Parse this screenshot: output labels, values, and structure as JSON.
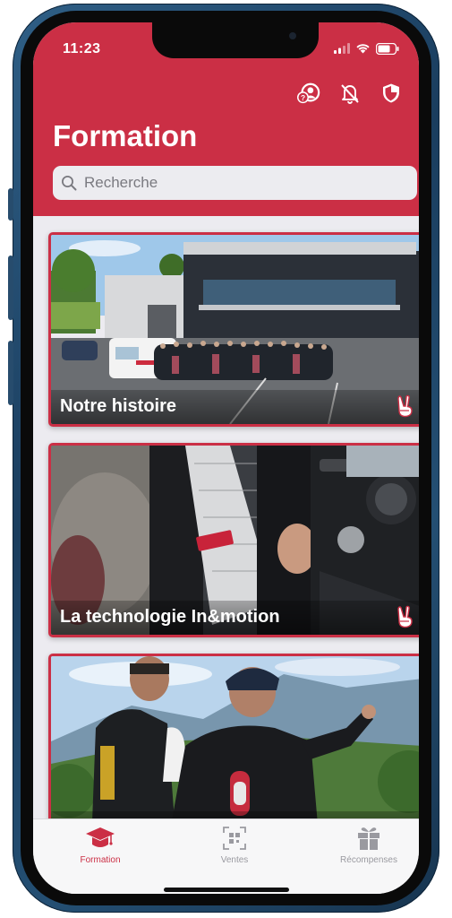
{
  "status_bar": {
    "time": "11:23"
  },
  "header": {
    "title": "Formation",
    "icons": [
      "help-user-icon",
      "notifications-off-icon",
      "shield-icon"
    ],
    "accent_color": "#cb2f45"
  },
  "search": {
    "placeholder": "Recherche",
    "value": ""
  },
  "cards": [
    {
      "title": "Notre histoire",
      "badge_icon": "peace-hand-icon"
    },
    {
      "title": "La technologie In&motion",
      "badge_icon": "peace-hand-icon"
    },
    {
      "title": "",
      "badge_icon": "peace-hand-icon"
    }
  ],
  "tabbar": {
    "active_color": "#cb2f45",
    "inactive_color": "#9a9aa0",
    "tabs": [
      {
        "label": "Formation",
        "icon": "graduation-cap-icon",
        "active": true
      },
      {
        "label": "Ventes",
        "icon": "qr-code-icon",
        "active": false
      },
      {
        "label": "Récompenses",
        "icon": "gift-icon",
        "active": false
      }
    ]
  }
}
